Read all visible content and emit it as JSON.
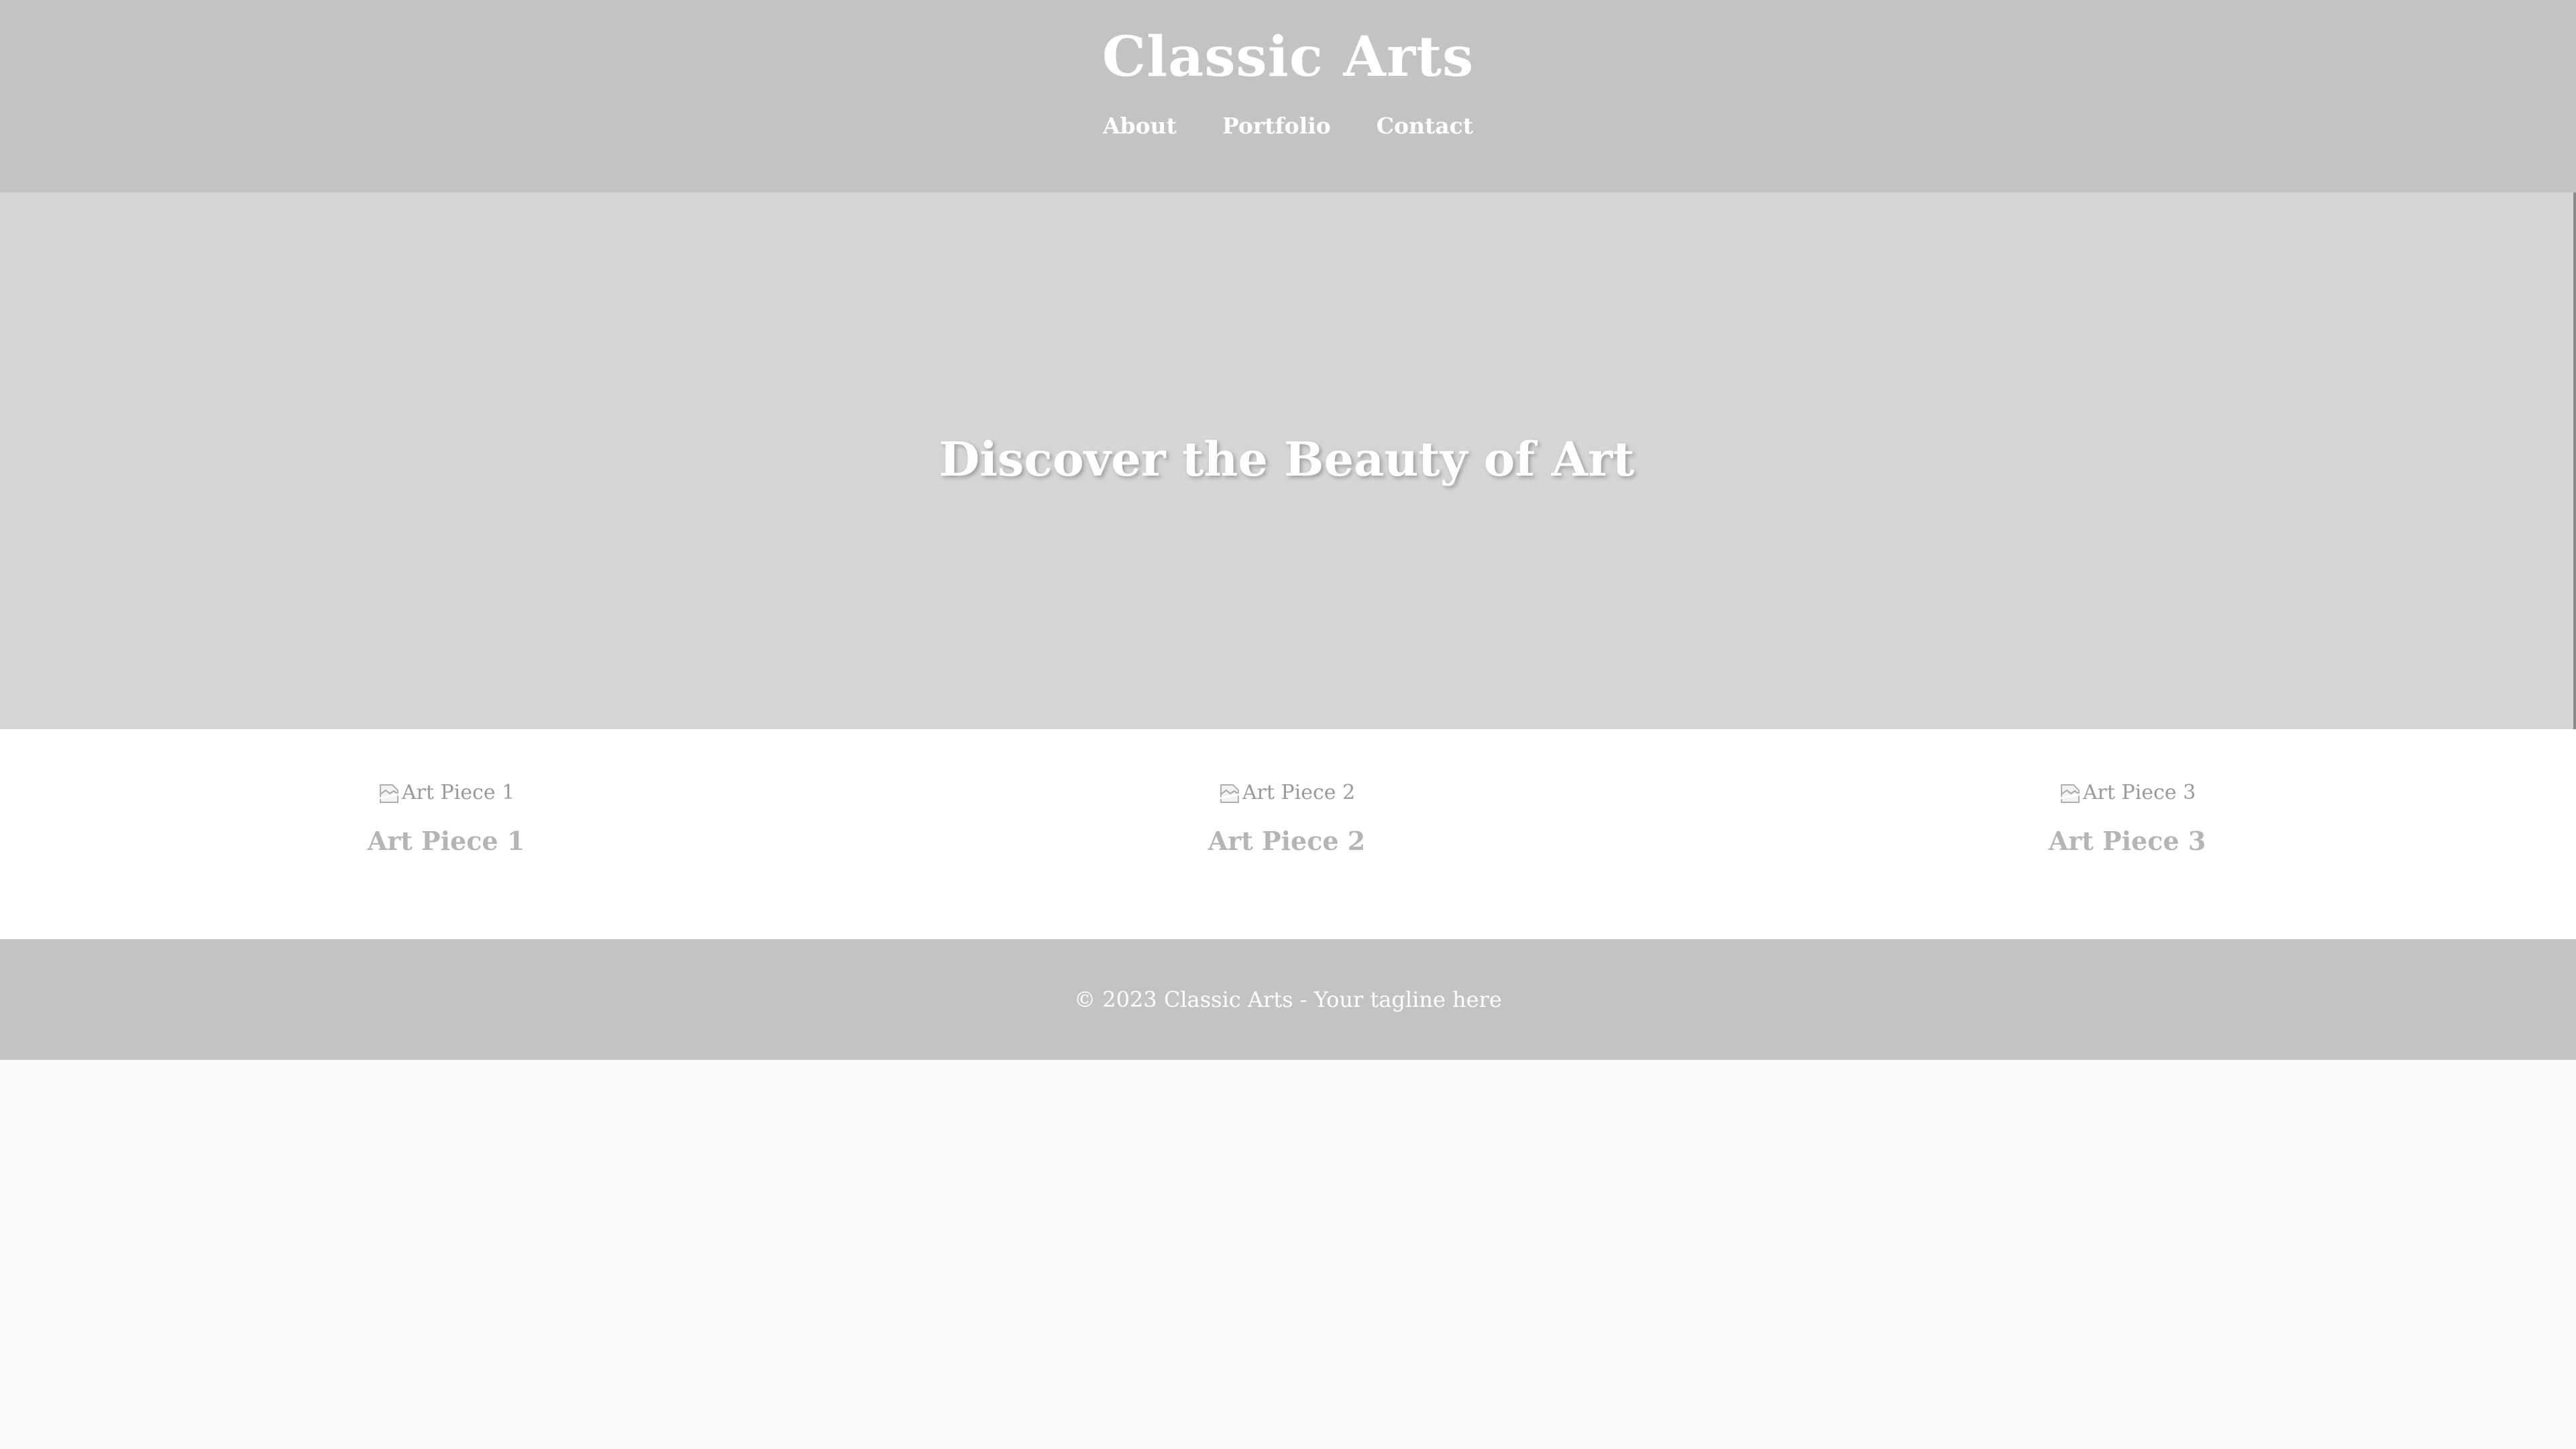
{
  "header": {
    "title": "Classic Arts",
    "nav": [
      "About",
      "Portfolio",
      "Contact"
    ]
  },
  "hero": {
    "heading": "Discover the Beauty of Art"
  },
  "gallery": {
    "items": [
      {
        "img_alt": "Art Piece 1",
        "caption": "Art Piece 1",
        "icon": "broken-image-icon"
      },
      {
        "img_alt": "Art Piece 2",
        "caption": "Art Piece 2",
        "icon": "broken-image-icon"
      },
      {
        "img_alt": "Art Piece 3",
        "caption": "Art Piece 3",
        "icon": "broken-image-icon"
      }
    ]
  },
  "footer": {
    "text": "© 2023 Classic Arts - Your tagline here"
  },
  "colors": {
    "header_bg": "#c3c3c3",
    "hero_bg": "#d6d6d6",
    "gallery_bg": "#ffffff",
    "footer_bg": "#c3c3c3",
    "page_bg": "#fafafa",
    "caption_text": "#b5b5b5",
    "header_text": "#ffffff"
  }
}
